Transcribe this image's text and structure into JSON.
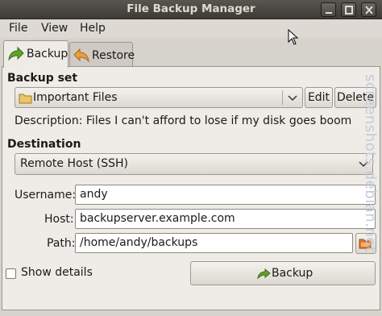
{
  "window": {
    "title": "File Backup Manager"
  },
  "menubar": {
    "items": [
      "File",
      "View",
      "Help"
    ]
  },
  "tabs": [
    {
      "label": "Backup",
      "icon": "backup-arrow-icon",
      "active": true
    },
    {
      "label": "Restore",
      "icon": "restore-arrow-icon",
      "active": false
    }
  ],
  "backup_set": {
    "heading": "Backup set",
    "selected": "Important Files",
    "edit_label": "Edit",
    "delete_label": "Delete",
    "description": "Description: Files I can't afford to lose if my disk goes boom"
  },
  "destination": {
    "heading": "Destination",
    "selected": "Remote Host (SSH)",
    "username_label": "Username:",
    "username": "andy",
    "host_label": "Host:",
    "host": "backupserver.example.com",
    "path_label": "Path:",
    "path": "/home/andy/backups"
  },
  "footer": {
    "show_details_label": "Show details",
    "show_details_checked": false,
    "backup_button_label": "Backup"
  },
  "watermark": "screenshots.debian.net",
  "colors": {
    "titlebar": "#3d3b36",
    "panel": "#efece8",
    "window_bg": "#d6d2cc"
  }
}
